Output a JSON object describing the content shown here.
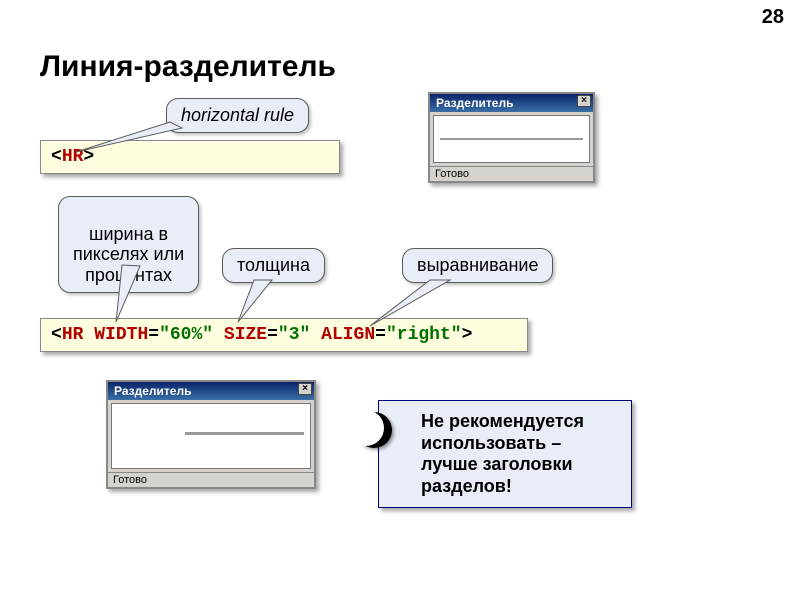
{
  "page_number": "28",
  "title": "Линия-разделитель",
  "callouts": {
    "hrule": "horizontal rule",
    "width": "ширина в\nпикселях или\nпроцентах",
    "size": "толщина",
    "align": "выравнивание"
  },
  "code1": {
    "lt1": "<",
    "tag": "HR",
    "gt1": ">"
  },
  "code2": {
    "lt": "<",
    "tag": "HR",
    "sp1": " ",
    "attr1": "WIDTH",
    "eq1": "=",
    "val1": "\"60%\"",
    "sp2": " ",
    "attr2": "SIZE",
    "eq2": "=",
    "val2": "\"3\"",
    "sp3": " ",
    "attr3": "ALIGN",
    "eq3": "=",
    "val3": "\"right\"",
    "gt": ">"
  },
  "window": {
    "title": "Разделитель",
    "status": "Готово",
    "close": "×"
  },
  "warning": {
    "badge": "!",
    "text": "Не рекомендуется использовать – лучше заголовки разделов!"
  }
}
